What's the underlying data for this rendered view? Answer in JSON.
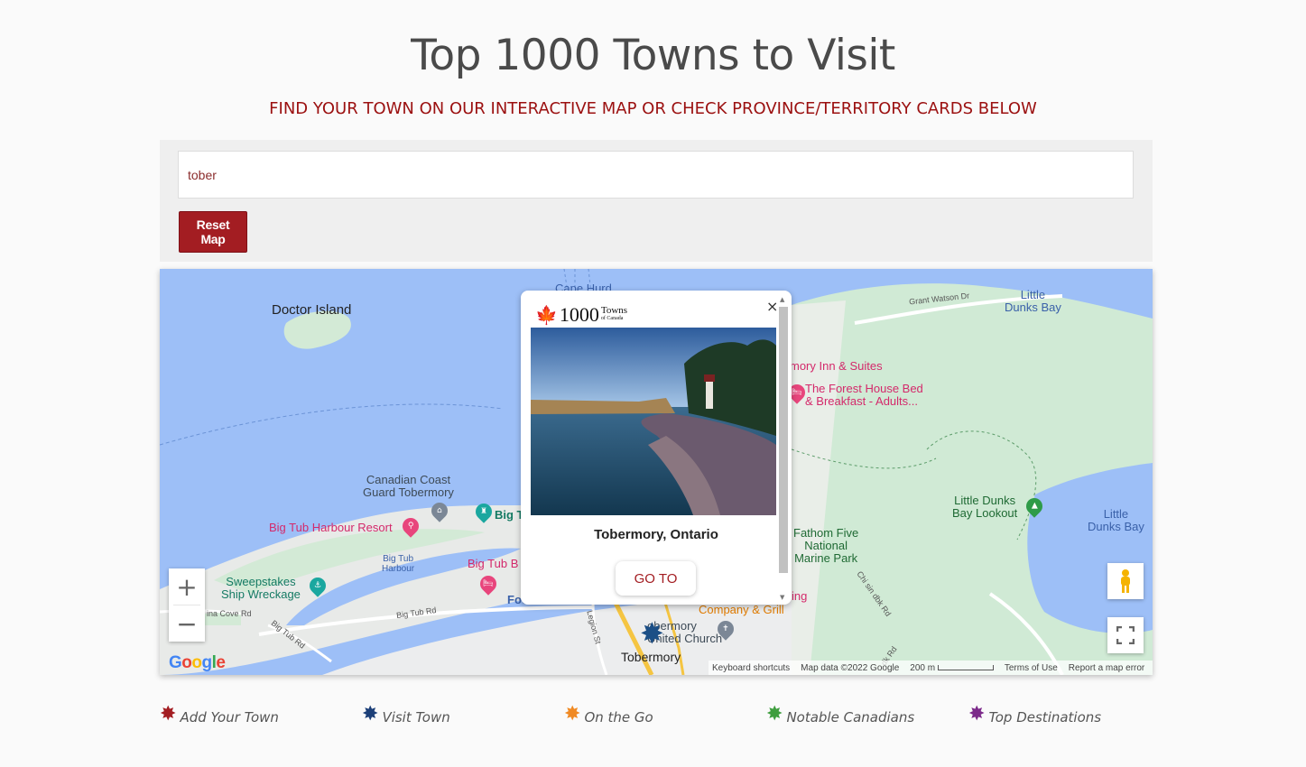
{
  "header": {
    "title": "Top 1000 Towns to Visit",
    "subtitle": "FIND YOUR TOWN ON OUR INTERACTIVE MAP OR CHECK PROVINCE/TERRITORY CARDS BELOW"
  },
  "search": {
    "value": "tober",
    "reset_label": "Reset Map"
  },
  "map": {
    "labels": {
      "doctor_island": "Doctor Island",
      "cape_hurd": "Cape Hurd",
      "grant_watson": "Grant Watson Dr",
      "little_dunks_bay_top": "Little\nDunks Bay",
      "inn_suites": "mory Inn & Suites",
      "forest_house": "The Forest House Bed\n& Breakfast - Adults...",
      "coast_guard": "Canadian Coast\nGuard Tobermory",
      "big_tub_harbour_resort": "Big Tub Harbour Resort",
      "big_t": "Big T",
      "big_tub_harbour": "Big Tub\nHarbour",
      "big_tub_b": "Big Tub B",
      "sweepstakes": "Sweepstakes\nShip Wreckage",
      "foo": "Foo",
      "fathom_five": "Fathom Five\nNational\nMarine Park",
      "little_dunks_lookout": "Little Dunks\nBay Lookout",
      "little_dunks_bay_right": "Little\nDunks Bay",
      "chi_sin_dbk": "Chi sin dbk Rd",
      "big_tub_rd_1": "Big Tub Rd",
      "big_tub_rd_2": "Big Tub Rd",
      "cove_rd": "ina Cove Rd",
      "legion_st": "Legion St",
      "dk_rd": "dk Rd",
      "company_grill": "Company & Grill",
      "ing": "ing",
      "church": "obermory\nUnited Church",
      "tobermory": "Tobermory"
    },
    "controls": {
      "zoom_in": "+",
      "zoom_out": "−"
    },
    "google": {
      "logo_parts": [
        "G",
        "o",
        "o",
        "g",
        "l",
        "e"
      ],
      "logo_colors": [
        "#4285F4",
        "#EA4335",
        "#FBBC05",
        "#4285F4",
        "#34A853",
        "#EA4335"
      ]
    },
    "attribution": {
      "shortcuts": "Keyboard shortcuts",
      "map_data": "Map data ©2022 Google",
      "scale": "200 m",
      "terms": "Terms of Use",
      "report": "Report a map error"
    },
    "popup": {
      "logo_number": "1000",
      "logo_towns": "Towns",
      "logo_of_canada": "of Canada",
      "town": "Tobermory, Ontario",
      "goto_label": "GO TO",
      "close_icon": "×"
    }
  },
  "legend": [
    {
      "label": "Add Your Town",
      "color": "#a31d22"
    },
    {
      "label": "Visit Town",
      "color": "#1c3f78"
    },
    {
      "label": "On the Go",
      "color": "#f08a24"
    },
    {
      "label": "Notable Canadians",
      "color": "#3f9e3f"
    },
    {
      "label": "Top Destinations",
      "color": "#7c2a8a"
    }
  ]
}
